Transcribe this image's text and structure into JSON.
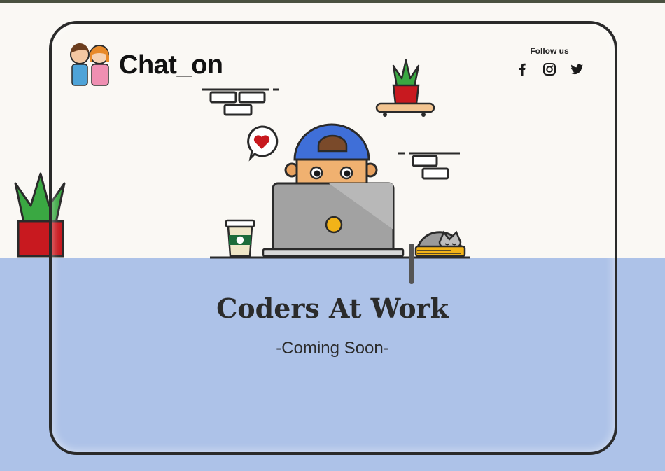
{
  "brand": {
    "name": "Chat_on",
    "logo_icon": "couple-avatar-icon"
  },
  "social": {
    "label": "Follow us",
    "icons": [
      "facebook-icon",
      "instagram-icon",
      "twitter-icon"
    ]
  },
  "hero": {
    "title": "Coders At Work",
    "subtitle": "-Coming Soon-"
  },
  "colors": {
    "page_background": "#faf8f4",
    "lower_band": "#adc2e8",
    "frame_border": "#2a2a2a",
    "cap_blue": "#3f6fd8",
    "pot_red": "#c8191f",
    "leaf_green": "#3aa842",
    "laptop_gray": "#9c9c9c",
    "heart_red": "#c8191f"
  }
}
